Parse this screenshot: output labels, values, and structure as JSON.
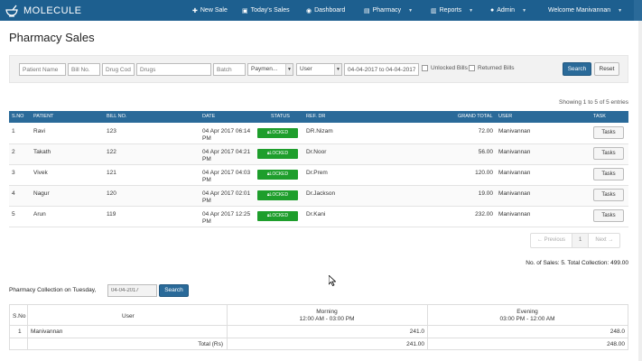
{
  "nav": {
    "brand": "MOLECULE",
    "new_sale": "New Sale",
    "todays_sales": "Today's Sales",
    "dashboard": "Dashboard",
    "pharmacy": "Pharmacy",
    "reports": "Reports",
    "admin": "Admin",
    "welcome": "Welcome Manivannan"
  },
  "page_title": "Pharmacy Sales",
  "filters": {
    "patient_name": "Patient Name",
    "bill_no": "Bill No.",
    "drug_code": "Drug Code",
    "drugs": "Drugs",
    "batch": "Batch",
    "payment": "Paymen...",
    "user": "User",
    "date_range": "04-04-2017 to 04-04-2017",
    "unlocked_bills": "Unlocked Bills",
    "returned_bills": "Returned Bills",
    "search_button": "Search",
    "reset_button": "Reset"
  },
  "showing_text": "Showing 1 to 5 of 5 entries",
  "table": {
    "headers": [
      "S.NO",
      "PATIENT",
      "BILL NO.",
      "DATE",
      "STATUS",
      "REF. DR",
      "GRAND TOTAL",
      "USER",
      "TASK"
    ],
    "rows": [
      {
        "sno": "1",
        "patient": "Ravi",
        "bill": "123",
        "date": "04 Apr 2017 06:14 PM",
        "status": "LOCKED",
        "ref": "DR.Nizam",
        "total": "72.00",
        "user": "Manivannan",
        "task": "Tasks"
      },
      {
        "sno": "2",
        "patient": "Takath",
        "bill": "122",
        "date": "04 Apr 2017 04:21 PM",
        "status": "LOCKED",
        "ref": "Dr.Noor",
        "total": "56.00",
        "user": "Manivannan",
        "task": "Tasks"
      },
      {
        "sno": "3",
        "patient": "Vivek",
        "bill": "121",
        "date": "04 Apr 2017 04:03 PM",
        "status": "LOCKED",
        "ref": "Dr.Prem",
        "total": "120.00",
        "user": "Manivannan",
        "task": "Tasks"
      },
      {
        "sno": "4",
        "patient": "Nagur",
        "bill": "120",
        "date": "04 Apr 2017 02:01 PM",
        "status": "LOCKED",
        "ref": "Dr.Jackson",
        "total": "19.00",
        "user": "Manivannan",
        "task": "Tasks"
      },
      {
        "sno": "5",
        "patient": "Arun",
        "bill": "119",
        "date": "04 Apr 2017 12:25 PM",
        "status": "LOCKED",
        "ref": "Dr.Kani",
        "total": "232.00",
        "user": "Manivannan",
        "task": "Tasks"
      }
    ]
  },
  "pagination": {
    "previous": "← Previous",
    "page": "1",
    "next": "Next →"
  },
  "collection_total": "No. of Sales: 5. Total Collection: 499.00",
  "collection": {
    "label": "Pharmacy Collection on Tuesday,",
    "date": "04-04-2017",
    "search_button": "Search",
    "headers": {
      "sno": "S.No",
      "user": "User",
      "morning": "Morning",
      "morning_time": "12:00 AM - 03:00 PM",
      "evening": "Evening",
      "evening_time": "03:00 PM - 12:00 AM"
    },
    "row": {
      "sno": "1",
      "user": "Manivannan",
      "morning": "241.0",
      "evening": "248.0"
    },
    "total_label": "Total (Rs)",
    "total_morning": "241.00",
    "total_evening": "248.00"
  },
  "colors": {
    "navbar": "#1d5f8f",
    "header": "#2a6a99",
    "locked": "#1e9e2c"
  }
}
